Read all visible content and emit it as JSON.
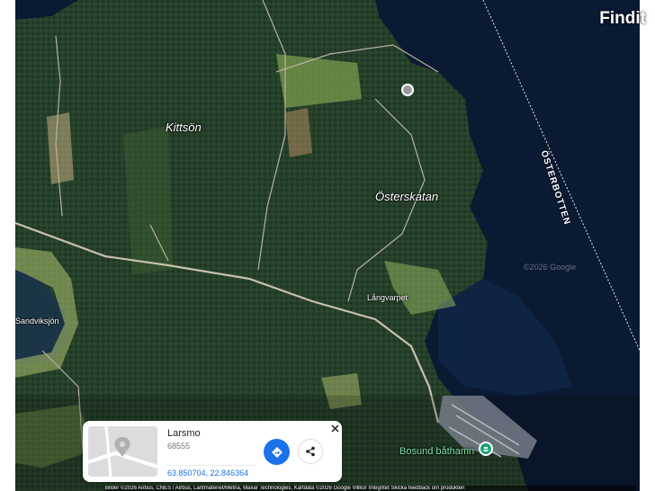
{
  "brand": {
    "name": "Findit"
  },
  "map": {
    "labels": {
      "kittson": "Kittsön",
      "osterskatan": "Österskatan",
      "langvarpet": "Långvarpet",
      "sandviksjon": "Sandviksjön",
      "osterbotten": "ÖSTERBOTTEN",
      "faint": "©2026 Google"
    },
    "poi": {
      "label": "Bosund båthamn",
      "icon": "ferry-icon",
      "color": "#18a472"
    },
    "attribution": "Bilder ©2026 Airbus, CNES / Airbus, Lantmäteriet/Metria, Maxar Technologies, Kartdata ©2026 Google  Villkor  Integritet  Skicka feedback om produkten"
  },
  "card": {
    "title": "Larsmo",
    "postal": "68555",
    "coords": "63.850704, 22.846364",
    "directions_icon": "directions-icon",
    "share_icon": "share-icon",
    "close_icon": "close-icon",
    "accent": "#1a73e8"
  }
}
